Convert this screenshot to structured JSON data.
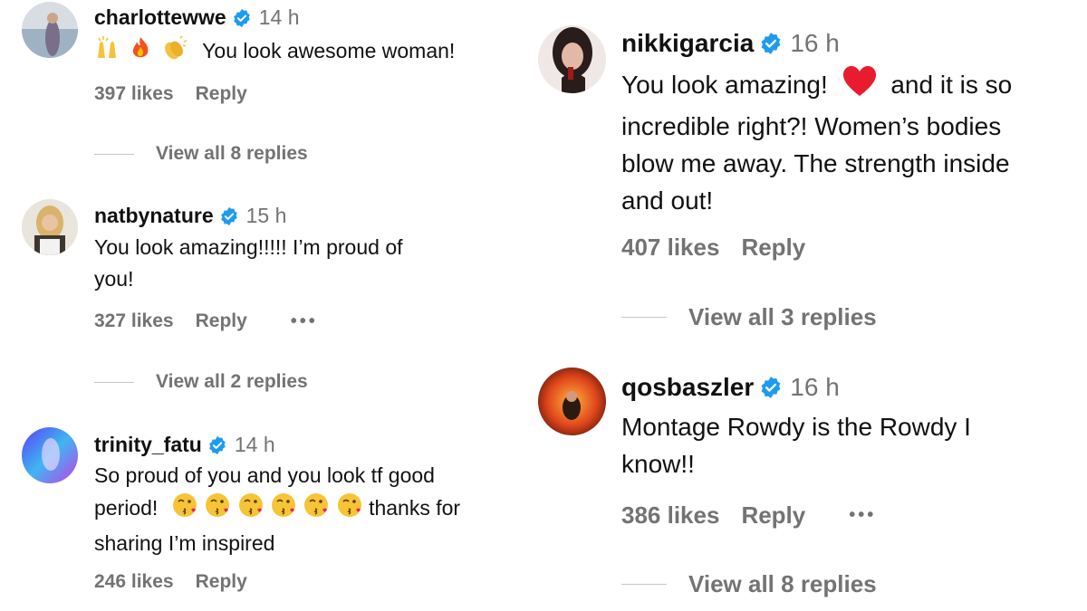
{
  "colors": {
    "text": "#111111",
    "muted": "#737373",
    "verified": "#1d9bf0",
    "heart": "#e0245e"
  },
  "left": [
    {
      "username": "charlottewwe",
      "time": "14 h",
      "emojis": [
        "raising-hands-icon",
        "fire-icon",
        "clapping-hands-icon"
      ],
      "text": "You look awesome woman!",
      "likes": "397 likes",
      "reply": "Reply",
      "view_replies": "View all 8 replies"
    },
    {
      "username": "natbynature",
      "time": "15 h",
      "text_line1": "You look amazing!!!!! I’m proud of",
      "text_line2": "you!",
      "likes": "327 likes",
      "reply": "Reply",
      "more": "•••",
      "view_replies": "View all 2 replies"
    },
    {
      "username": "trinity_fatu",
      "time": "14 h",
      "text_line1": "So proud of you and you look tf good",
      "text_line2_a": "period!",
      "text_line2_b": "thanks for",
      "text_line3": "sharing I’m inspired",
      "emojis": [
        "kissing-face-icon",
        "kissing-face-icon",
        "kissing-face-icon",
        "kissing-face-icon",
        "kissing-face-icon",
        "kissing-face-icon"
      ],
      "likes": "246 likes",
      "reply": "Reply"
    }
  ],
  "right": [
    {
      "username": "nikkigarcia",
      "time": "16 h",
      "text_line1_a": "You look amazing!",
      "text_line1_b": "and it is so",
      "text_line2": "incredible right?! Women’s bodies",
      "text_line3": "blow me away. The strength inside",
      "text_line4": "and out!",
      "emoji": "red-heart-icon",
      "likes": "407 likes",
      "reply": "Reply",
      "view_replies": "View all 3 replies"
    },
    {
      "username": "qosbaszler",
      "time": "16 h",
      "text_line1": "Montage Rowdy is the Rowdy I",
      "text_line2": "know!!",
      "likes": "386 likes",
      "reply": "Reply",
      "more": "•••",
      "view_replies": "View all 8 replies"
    }
  ]
}
